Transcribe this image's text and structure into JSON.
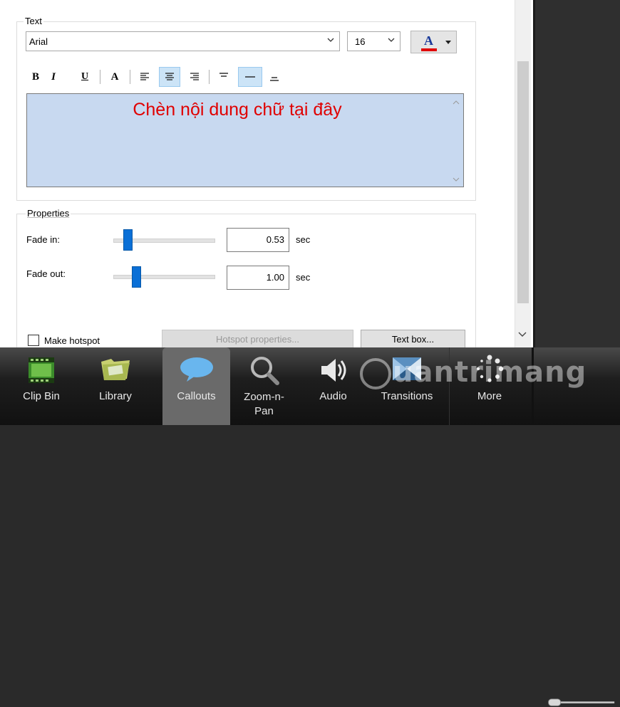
{
  "text_section": {
    "legend": "Text",
    "font": "Arial",
    "size": "16",
    "color_icon_label": "A",
    "format_buttons": [
      "B",
      "I",
      "U",
      "A"
    ],
    "content": "Chèn nội dung chữ tại đây"
  },
  "properties": {
    "legend": "Properties",
    "fade_in_label": "Fade in:",
    "fade_in_value": "0.53",
    "fade_out_label": "Fade out:",
    "fade_out_value": "1.00",
    "unit": "sec",
    "fade_in_level": 0.14,
    "fade_out_level": 0.23
  },
  "bottom": {
    "make_hotspot": "Make hotspot",
    "hotspot_properties": "Hotspot properties...",
    "text_box": "Text box..."
  },
  "tabs": [
    {
      "label": "Clip Bin",
      "icon": "film-icon"
    },
    {
      "label": "Library",
      "icon": "folder-icon"
    },
    {
      "label": "Callouts",
      "icon": "speech-bubble-icon"
    },
    {
      "label": "Zoom-n-\nPan",
      "icon": "magnifier-icon"
    },
    {
      "label": "Audio",
      "icon": "speaker-icon"
    },
    {
      "label": "Transitions",
      "icon": "transition-icon"
    },
    {
      "label": "More",
      "icon": "dots-icon"
    }
  ],
  "watermark": "uantrimang"
}
